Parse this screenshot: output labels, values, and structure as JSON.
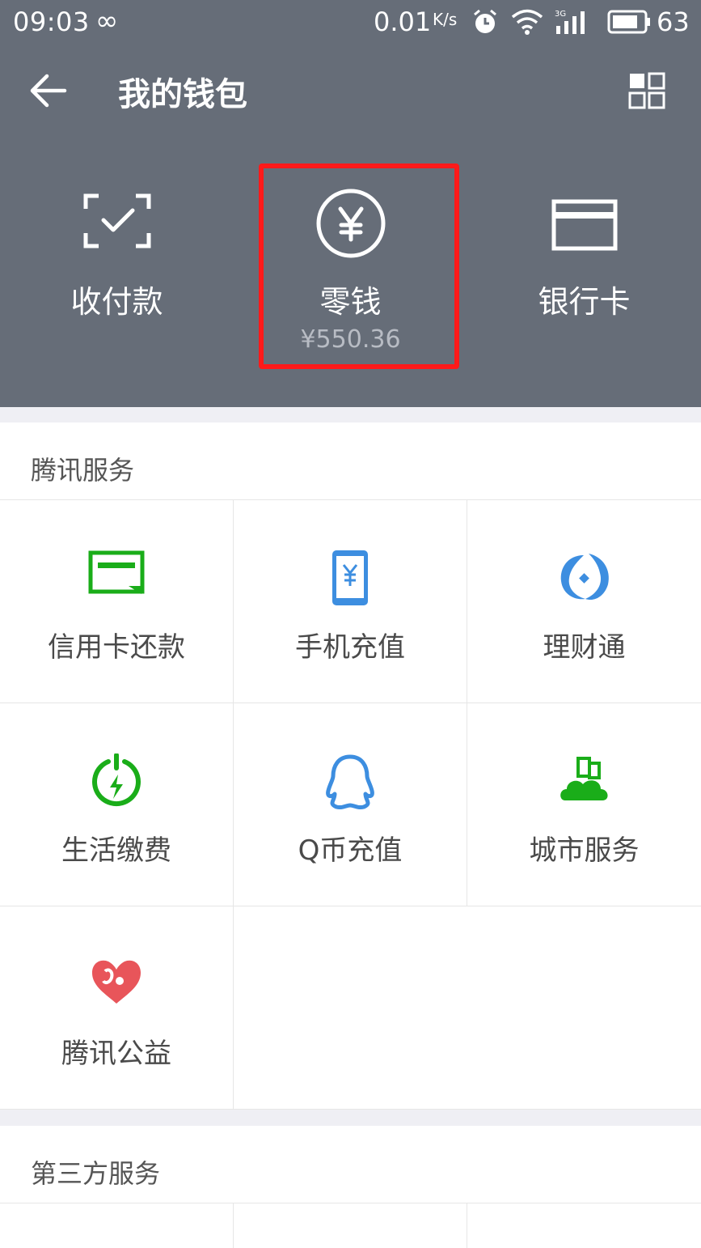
{
  "status_bar": {
    "time": "09:03",
    "infinity": "∞",
    "rate": "0.01",
    "rate_unit": "K/s",
    "battery": "63",
    "icons": [
      "alarm-icon",
      "wifi-icon",
      "signal-icon",
      "battery-icon"
    ]
  },
  "header": {
    "title": "我的钱包",
    "actions": [
      {
        "label": "收付款",
        "icon": "scan-check-icon"
      },
      {
        "label": "零钱",
        "amount": "¥550.36",
        "icon": "yuan-circle-icon"
      },
      {
        "label": "银行卡",
        "icon": "bank-card-icon"
      }
    ]
  },
  "tencent_services": {
    "title": "腾讯服务",
    "items": [
      {
        "label": "信用卡还款",
        "icon": "credit-card-repay-icon",
        "color": "#1aad19"
      },
      {
        "label": "手机充值",
        "icon": "phone-recharge-icon",
        "color": "#3d8ee0"
      },
      {
        "label": "理财通",
        "icon": "licaitong-icon",
        "color": "#3d8ee0"
      },
      {
        "label": "生活缴费",
        "icon": "utility-bill-icon",
        "color": "#1aad19"
      },
      {
        "label": "Q币充值",
        "icon": "qq-coin-icon",
        "color": "#3d8ee0"
      },
      {
        "label": "城市服务",
        "icon": "city-service-icon",
        "color": "#1aad19"
      },
      {
        "label": "腾讯公益",
        "icon": "charity-heart-icon",
        "color": "#e8555a"
      }
    ]
  },
  "third_party": {
    "title": "第三方服务"
  },
  "colors": {
    "header_bg": "#666d78",
    "highlight": "#ff1a1a"
  }
}
